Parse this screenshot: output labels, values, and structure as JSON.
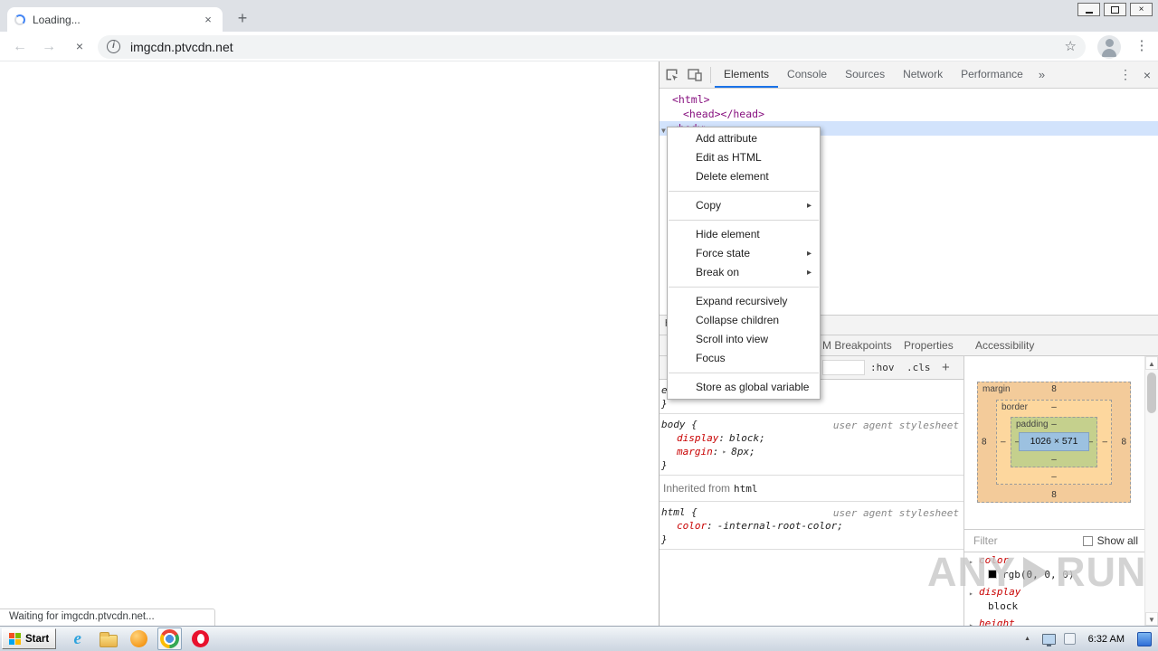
{
  "icons": {
    "close": "×",
    "new_tab": "+",
    "back": "←",
    "forward": "→",
    "stop": "×",
    "info": "i",
    "star": "☆",
    "kebab": "⋮",
    "overflow": "»",
    "submenu": "▸",
    "expand": "▸",
    "tree_arrow": "▼",
    "scroll_up": "▲",
    "scroll_down": "▼",
    "tray_arrow": "▲",
    "ie_letter": "e"
  },
  "browser": {
    "tab_title": "Loading...",
    "url": "imgcdn.ptvcdn.net",
    "status_text": "Waiting for imgcdn.ptvcdn.net..."
  },
  "devtools": {
    "tabs": [
      "Elements",
      "Console",
      "Sources",
      "Network",
      "Performance"
    ],
    "tree": {
      "html_tag": "<html>",
      "head_tag": "<head></head>",
      "body_tag": "<body>"
    },
    "breadcrumb_html": "html",
    "context_menu": {
      "items": [
        "Add attribute",
        "Edit as HTML",
        "Delete element",
        "Copy",
        "Hide element",
        "Force state",
        "Break on",
        "Expand recursively",
        "Collapse children",
        "Scroll into view",
        "Focus",
        "Store as global variable"
      ]
    },
    "sidebar_tabs": [
      "M Breakpoints",
      "Properties",
      "Accessibility"
    ],
    "styles": {
      "pseudo_button": ":hov",
      "class_button": ".cls",
      "new_rule_button": "+",
      "element_style": {
        "selector": "element.style",
        "open": "{",
        "close": "}"
      },
      "rules": [
        {
          "selector": "body",
          "open": "{",
          "origin": "user agent stylesheet",
          "props": [
            {
              "name": "display",
              "value": "block;"
            },
            {
              "name": "margin",
              "value": "8px;"
            }
          ],
          "close": "}"
        },
        {
          "selector": "html",
          "open": "{",
          "origin": "user agent stylesheet",
          "props": [
            {
              "name": "color",
              "value": "-internal-root-color;"
            }
          ],
          "close": "}"
        }
      ],
      "inherited_label": "Inherited from",
      "inherited_selector": "html"
    },
    "box_model": {
      "margin_label": "margin",
      "border_label": "border",
      "padding_label": "padding",
      "content_size": "1026 × 571",
      "margin": {
        "top": "8",
        "right": "8",
        "bottom": "8",
        "left": "8"
      },
      "border": {
        "top": "–",
        "right": "–",
        "bottom": "–",
        "left": "–"
      },
      "padding": {
        "top": "–",
        "right": "–",
        "bottom": "–",
        "left": "–"
      }
    },
    "computed": {
      "filter_label": "Filter",
      "show_all_label": "Show all",
      "properties": [
        {
          "name": "color",
          "value": "rgb(0, 0, 0)"
        },
        {
          "name": "display",
          "value": "block"
        },
        {
          "name": "height",
          "value": ""
        }
      ]
    }
  },
  "taskbar": {
    "start_label": "Start",
    "clock": "6:32 AM"
  },
  "watermark": {
    "left": "ANY",
    "right": "RUN"
  }
}
